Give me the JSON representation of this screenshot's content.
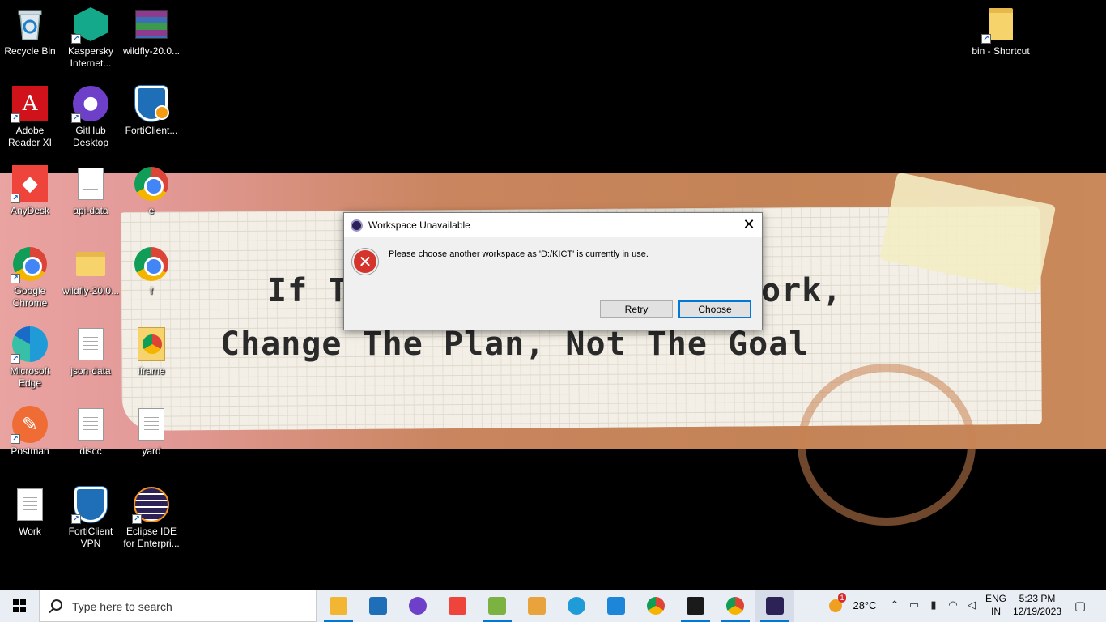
{
  "wallpaper": {
    "line1_left": "If T",
    "line1_right": "ork,",
    "line2": "Change The Plan, Not The Goal"
  },
  "desktop_icons": [
    {
      "label": "Recycle Bin",
      "icon": "recycle-bin-icon"
    },
    {
      "label": "Kaspersky Internet...",
      "icon": "kaspersky-icon"
    },
    {
      "label": "wildfly-20.0...",
      "icon": "winrar-archive-icon"
    },
    {
      "label": "Adobe Reader XI",
      "icon": "adobe-reader-icon"
    },
    {
      "label": "GitHub Desktop",
      "icon": "github-desktop-icon"
    },
    {
      "label": "FortiClient...",
      "icon": "forticlient-settings-icon"
    },
    {
      "label": "AnyDesk",
      "icon": "anydesk-icon"
    },
    {
      "label": "api-data",
      "icon": "text-file-icon"
    },
    {
      "label": "e",
      "icon": "chrome-icon"
    },
    {
      "label": "Google Chrome",
      "icon": "chrome-icon"
    },
    {
      "label": "wildfly-20.0...",
      "icon": "folder-icon"
    },
    {
      "label": "f",
      "icon": "chrome-icon"
    },
    {
      "label": "Microsoft Edge",
      "icon": "edge-icon"
    },
    {
      "label": "json-data",
      "icon": "text-file-icon"
    },
    {
      "label": "iframe",
      "icon": "chrome-html-file-icon"
    },
    {
      "label": "Postman",
      "icon": "postman-icon"
    },
    {
      "label": "discc",
      "icon": "text-file-icon"
    },
    {
      "label": "yard",
      "icon": "text-file-icon"
    },
    {
      "label": "Work",
      "icon": "text-file-icon"
    },
    {
      "label": "FortiClient VPN",
      "icon": "forticlient-vpn-icon"
    },
    {
      "label": "Eclipse IDE for Enterpri...",
      "icon": "eclipse-icon"
    },
    {
      "label": "bin - Shortcut",
      "icon": "folder-shortcut-icon"
    }
  ],
  "dialog": {
    "title": "Workspace Unavailable",
    "message": "Please choose another workspace as 'D:/KICT' is currently in use.",
    "retry_label": "Retry",
    "choose_label": "Choose",
    "close_glyph": "✕"
  },
  "taskbar": {
    "search_placeholder": "Type here to search",
    "weather_temp": "28°C",
    "weather_badge": "1",
    "lang_line1": "ENG",
    "lang_line2": "IN",
    "time": "5:23 PM",
    "date": "12/19/2023",
    "apps": [
      {
        "name": "file-explorer",
        "color": "#f2b632"
      },
      {
        "name": "forticlient",
        "color": "#1f6fb8"
      },
      {
        "name": "github-desktop",
        "color": "#6e40c9"
      },
      {
        "name": "anydesk",
        "color": "#ef443b"
      },
      {
        "name": "notepad-plus",
        "color": "#7bb241"
      },
      {
        "name": "file-tool",
        "color": "#e8a33d"
      },
      {
        "name": "edge",
        "color": "#1f9bd8"
      },
      {
        "name": "vscode",
        "color": "#1e86d8"
      },
      {
        "name": "chrome",
        "color": "#db4437"
      },
      {
        "name": "terminal",
        "color": "#1a1a1a"
      },
      {
        "name": "chrome-profile",
        "color": "#db4437"
      },
      {
        "name": "eclipse",
        "color": "#2c2255"
      }
    ]
  }
}
